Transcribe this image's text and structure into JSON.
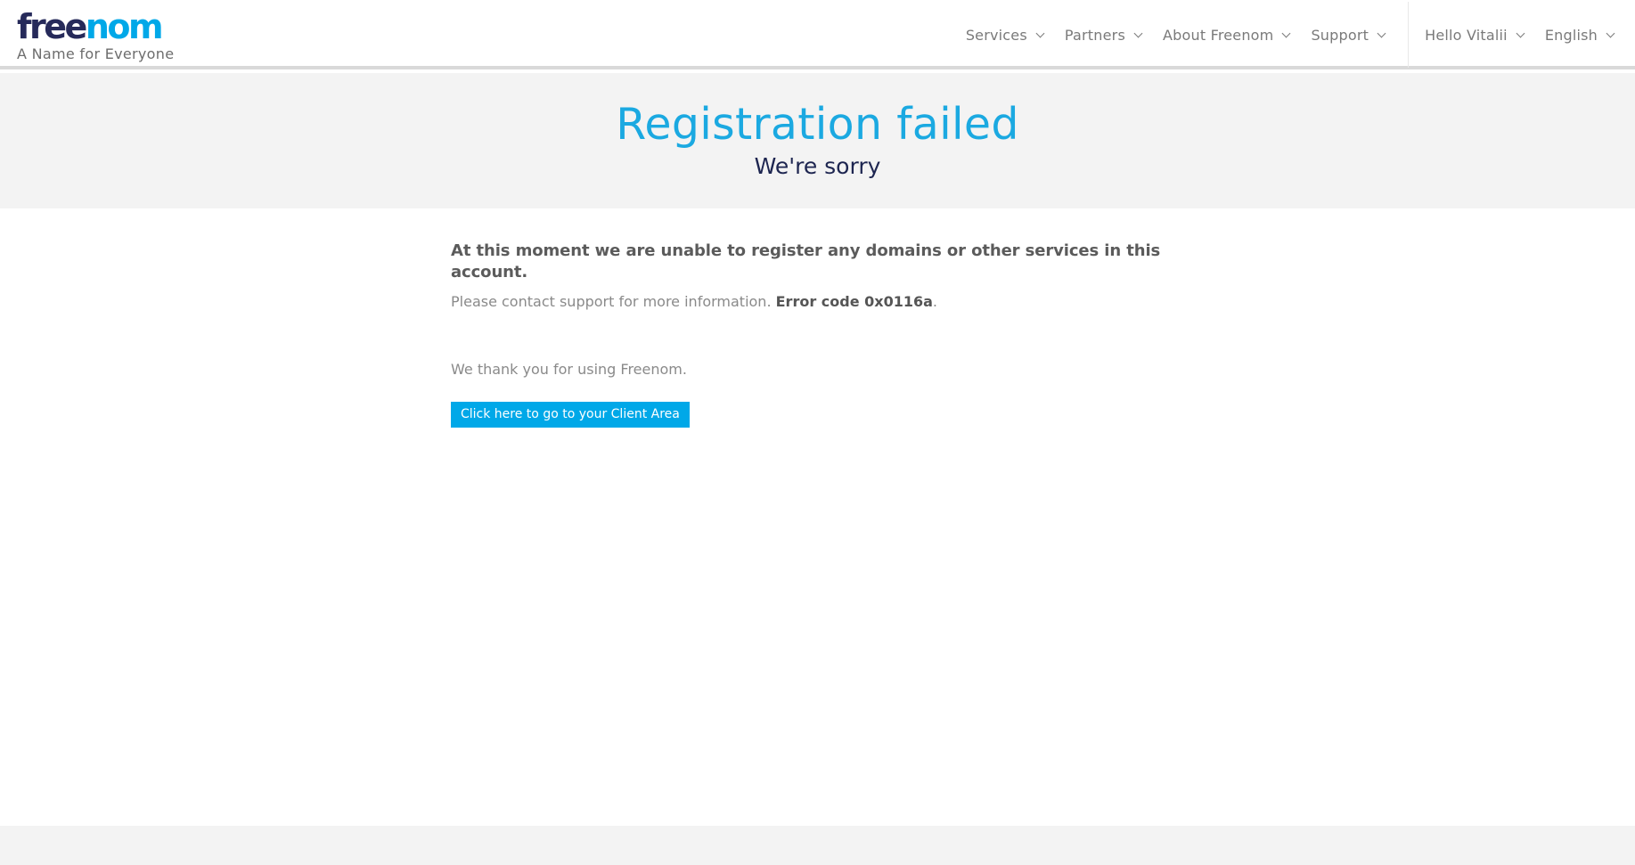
{
  "brand": {
    "logo_part1": "free",
    "logo_part2": "nom",
    "tagline": "A Name for Everyone",
    "colors": {
      "dark": "#262a5a",
      "accent": "#00a8e8"
    }
  },
  "nav": {
    "items": [
      {
        "label": "Services",
        "icon": "chevron-down-icon"
      },
      {
        "label": "Partners",
        "icon": "chevron-down-icon"
      },
      {
        "label": "About Freenom",
        "icon": "chevron-down-icon"
      },
      {
        "label": "Support",
        "icon": "chevron-down-icon"
      }
    ],
    "user": {
      "label": "Hello Vitalii",
      "icon": "chevron-down-icon"
    },
    "language": {
      "label": "English",
      "icon": "chevron-down-icon"
    }
  },
  "hero": {
    "title": "Registration failed",
    "subtitle": "We're sorry"
  },
  "main": {
    "lead": "At this moment we are unable to register any domains or other services in this account.",
    "info_text": "Please contact support for more information. ",
    "error_code": "Error code 0x0116a",
    "info_suffix": ".",
    "thanks": "We thank you for using Freenom.",
    "button_label": "Click here to go to your Client Area"
  }
}
